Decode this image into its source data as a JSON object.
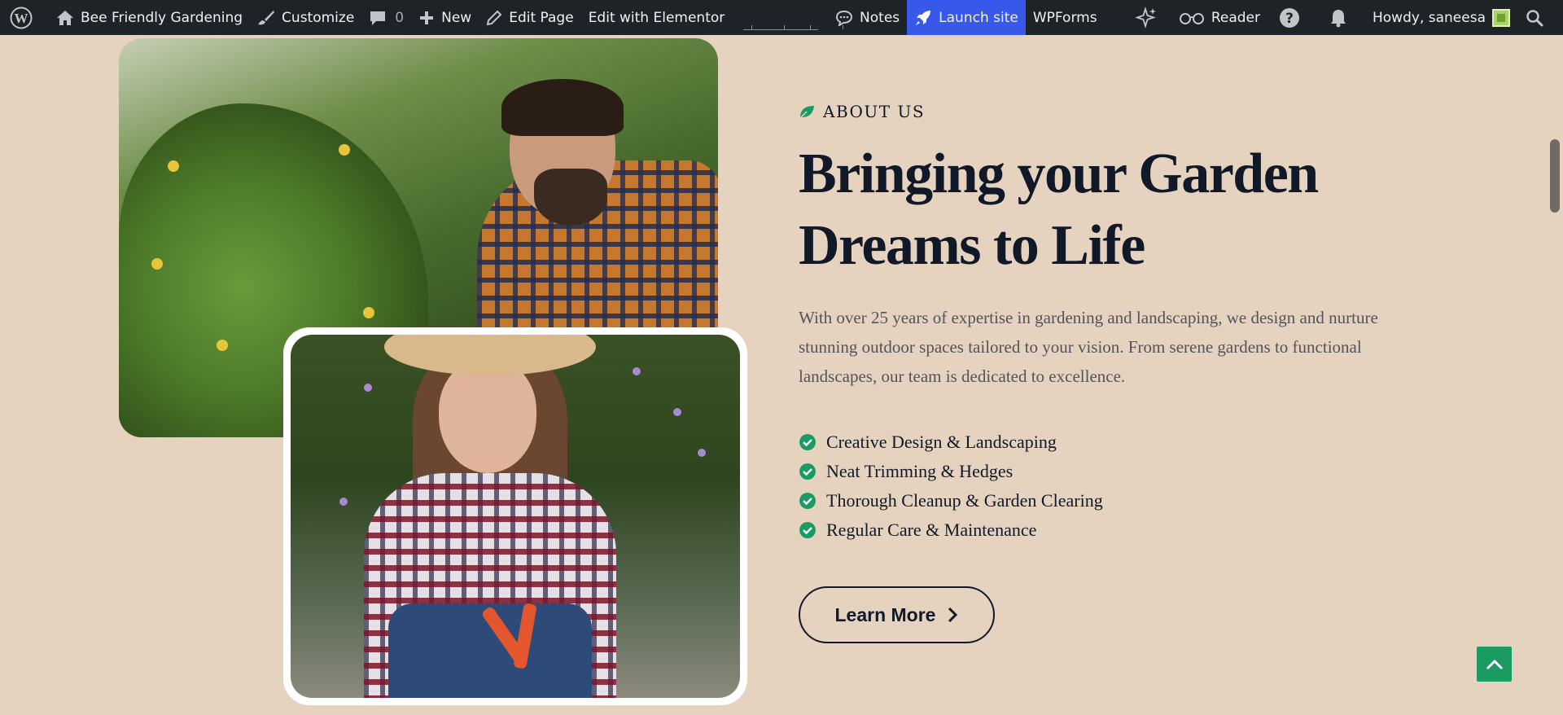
{
  "admin_bar": {
    "site_name": "Bee Friendly Gardening",
    "customize": "Customize",
    "comments_count": "0",
    "new": "New",
    "edit_page": "Edit Page",
    "edit_elementor": "Edit with Elementor",
    "notes": "Notes",
    "launch_site": "Launch site",
    "wpforms": "WPForms",
    "reader": "Reader",
    "howdy": "Howdy, saneesa",
    "icons": [
      "wordpress-icon",
      "home-icon",
      "brush-icon",
      "comment-icon",
      "plus-icon",
      "pencil-icon",
      "notes-icon",
      "rocket-icon",
      "sparkle-icon",
      "reader-glasses-icon",
      "help-icon",
      "bell-icon",
      "search-icon"
    ],
    "colors": {
      "bar": "#1d2327",
      "launch": "#3858e9"
    }
  },
  "about": {
    "eyebrow": "ABOUT US",
    "heading_line1": "Bringing your Garden",
    "heading_line2": "Dreams to Life",
    "paragraph": "With over 25 years of expertise in gardening and landscaping, we design and nurture stunning outdoor spaces tailored to your vision. From serene gardens to functional landscapes, our team is dedicated to excellence.",
    "features": [
      "Creative Design & Landscaping",
      "Neat Trimming & Hedges",
      "Thorough Cleanup & Garden Clearing",
      "Regular Care & Maintenance"
    ],
    "button_label": "Learn More"
  },
  "colors": {
    "page_bg": "#e5d3bf",
    "accent_green": "#1a9b61",
    "heading": "#111827",
    "body_text": "#55525a"
  }
}
